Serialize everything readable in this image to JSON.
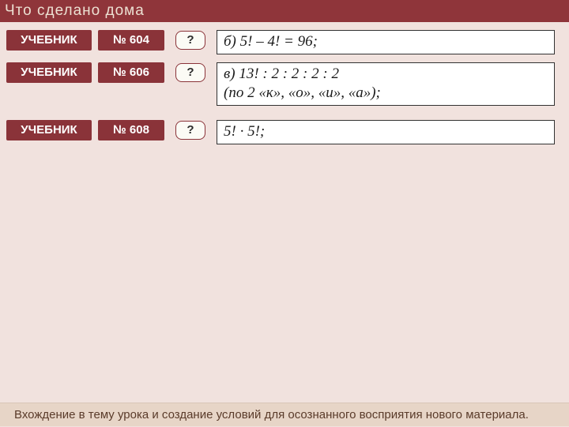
{
  "header": {
    "title": "Что  сделано  дома"
  },
  "rows": [
    {
      "source_label": "УЧЕБНИК",
      "number_label": "№ 604",
      "help_label": "?",
      "answer_line1": "б) 5! – 4! = 96;",
      "answer_line2": ""
    },
    {
      "source_label": "УЧЕБНИК",
      "number_label": "№ 606",
      "help_label": "?",
      "answer_line1": "в) 13! : 2 : 2 : 2 : 2",
      "answer_line2": "(по 2 «к», «о», «и», «а»);"
    },
    {
      "source_label": "УЧЕБНИК",
      "number_label": "№ 608",
      "help_label": "?",
      "answer_line1": "5! · 5!;",
      "answer_line2": ""
    }
  ],
  "footer": {
    "text": "Вхождение в тему урока и создание условий для осознанного восприятия нового материала."
  }
}
